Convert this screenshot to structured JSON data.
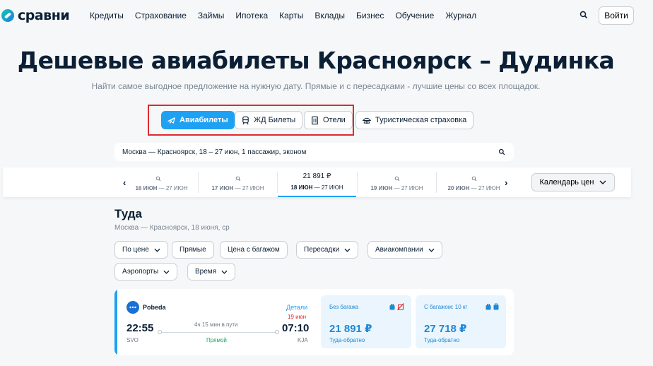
{
  "header": {
    "logo_text": "сравни",
    "nav": [
      "Кредиты",
      "Страхование",
      "Займы",
      "Ипотека",
      "Карты",
      "Вклады",
      "Бизнес",
      "Обучение",
      "Журнал"
    ],
    "login_label": "Войти"
  },
  "hero": {
    "title": "Дешевые авиабилеты Красноярск – Дудинка",
    "subtitle": "Найти самое выгодное предложение на нужную дату. Прямые и с пересадками - лучшие цены со всех площадок."
  },
  "tabs": [
    {
      "label": "Авиабилеты",
      "icon": "plane-icon",
      "active": true
    },
    {
      "label": "ЖД Билеты",
      "icon": "train-icon",
      "active": false
    },
    {
      "label": "Отели",
      "icon": "building-icon",
      "active": false
    },
    {
      "label": "Туристическая страховка",
      "icon": "umbrella-icon",
      "active": false
    }
  ],
  "search_summary": "Москва — Красноярск, 18 – 27 июн, 1 пассажир, эконом",
  "date_strip": {
    "cells": [
      {
        "price": "",
        "start": "16 ИЮН",
        "end": "27 ИЮН",
        "selected": false
      },
      {
        "price": "",
        "start": "17 ИЮН",
        "end": "27 ИЮН",
        "selected": false
      },
      {
        "price": "21 891 ₽",
        "start": "18 ИЮН",
        "end": "27 ИЮН",
        "selected": true
      },
      {
        "price": "",
        "start": "19 ИЮН",
        "end": "27 ИЮН",
        "selected": false
      },
      {
        "price": "",
        "start": "20 ИЮН",
        "end": "27 ИЮН",
        "selected": false
      }
    ],
    "range_separator": " — ",
    "calendar_label": "Календарь цен"
  },
  "results": {
    "title": "Туда",
    "subtitle": "Москва — Красноярск,  18 июня, ср",
    "filters": [
      "По цене",
      "Прямые",
      "Цена с багажом",
      "Пересадки",
      "Авиакомпании",
      "Аэропорты",
      "Время"
    ]
  },
  "ticket": {
    "airline": "Pobeda",
    "details_label": "Детали",
    "arrival_date": "19 июн",
    "departure_time": "22:55",
    "departure_code": "SVO",
    "arrival_time": "07:10",
    "arrival_code": "KJA",
    "duration": "4ч 15 мин в пути",
    "stops": "Прямой",
    "fares": [
      {
        "label": "Без багажа",
        "price": "21 891 ₽",
        "note": "Туда-обратно"
      },
      {
        "label": "С багажом: 10 кг",
        "price": "27 718 ₽",
        "note": "Туда-обратно"
      }
    ]
  },
  "colors": {
    "accent": "#1ea1f2",
    "highlight_box": "#e0292e",
    "direct": "#18a957"
  }
}
